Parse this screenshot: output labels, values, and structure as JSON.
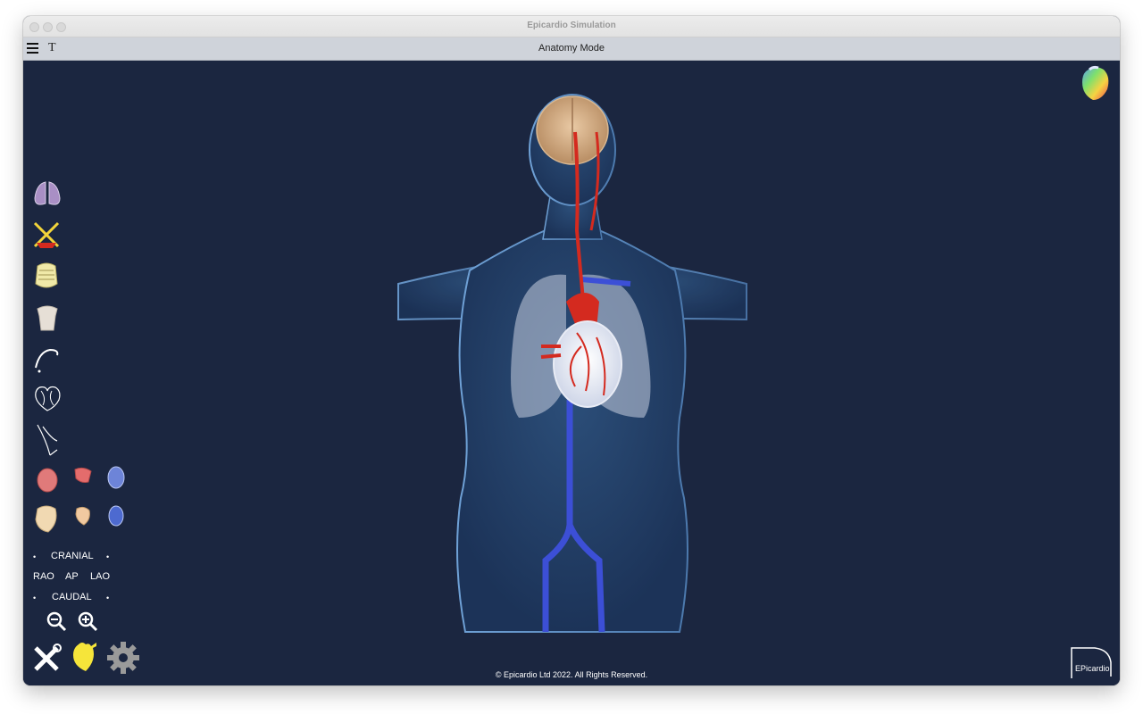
{
  "window": {
    "title": "Epicardio Simulation"
  },
  "toolbar": {
    "menu_icon": "hamburger-menu-icon",
    "text_icon": "T",
    "mode_label": "Anatomy Mode"
  },
  "side_tools": [
    "lungs-icon",
    "cross-ribs-icon",
    "ribcage-icon",
    "torso-icon",
    "catheter-icon",
    "heart-wireframe-icon",
    "vessel-wireframe-icon"
  ],
  "heart_views": [
    "heart-red-icon",
    "heart-section-icon",
    "heart-blue-icon",
    "heart-bone-icon",
    "heart-small-bone-icon",
    "heart-blue-small-icon"
  ],
  "navigation": {
    "cranial": "CRANIAL",
    "rao": "RAO",
    "ap": "AP",
    "lao": "LAO",
    "caudal": "CAUDAL",
    "bullet": "•"
  },
  "zoom": {
    "out": "zoom-out-icon",
    "in": "zoom-in-icon"
  },
  "bottom_tools": [
    "tools-icon",
    "heart-yellow-icon",
    "settings-gear-icon"
  ],
  "footer": "© Epicardio Ltd 2022. All Rights Reserved.",
  "logo": {
    "text": "EPicardio"
  },
  "colors": {
    "background": "#1b2640",
    "toolbar": "#cfd3da",
    "artery": "#d42a1f",
    "vein": "#3c4fd6"
  }
}
